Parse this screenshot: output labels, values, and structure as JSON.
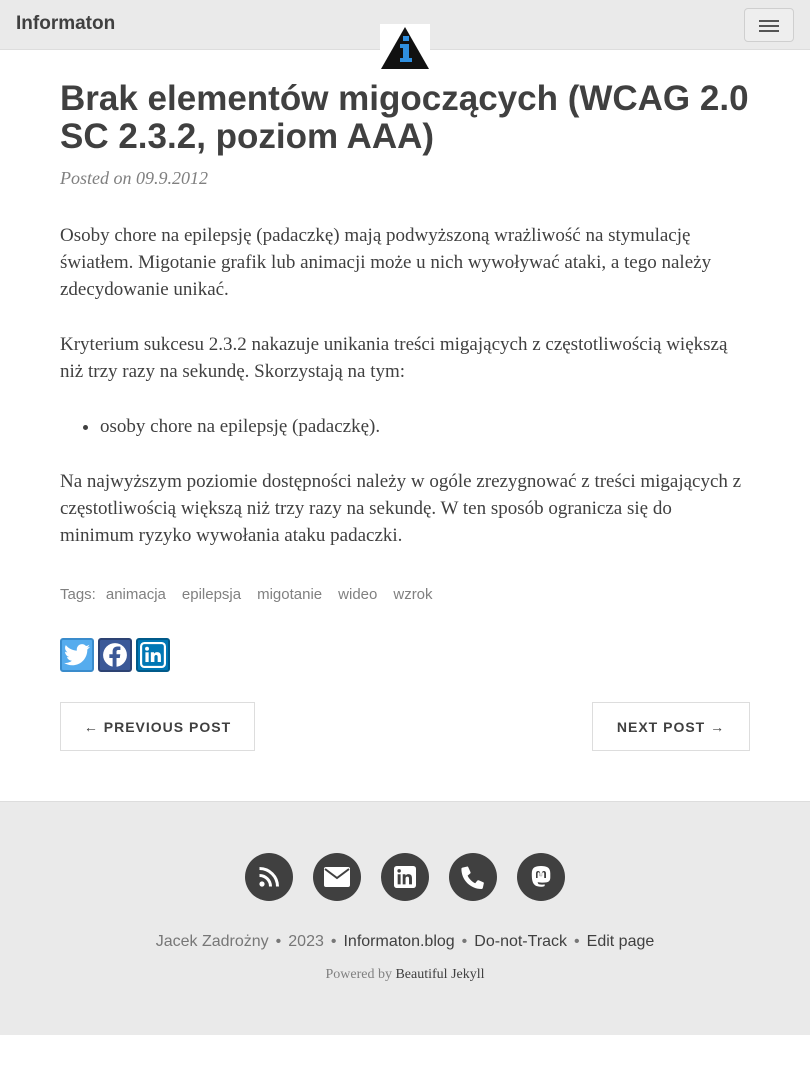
{
  "navbar": {
    "brand": "Informaton",
    "logo_icon": "info-triangle-logo",
    "menu_icon": "hamburger-icon"
  },
  "post": {
    "title": "Brak elementów migoczących (WCAG 2.0 SC 2.3.2, poziom AAA)",
    "meta": "Posted on 09.9.2012",
    "paragraphs": [
      "Osoby chore na epilepsję (padaczkę) mają podwyższoną wrażliwość na stymulację światłem. Migotanie grafik lub animacji może u nich wywoływać ataki, a tego należy zdecydowanie unikać.",
      "Kryterium sukcesu 2.3.2 nakazuje unikania treści migających z częstotliwością większą niż trzy razy na sekundę. Skorzystają na tym:",
      "Na najwyższym poziomie dostępności należy w ogóle zrezygnować z treści migających z częstotliwością większą niż trzy razy na sekundę. W ten sposób ogranicza się do minimum ryzyko wywołania ataku padaczki."
    ],
    "list_items": [
      "osoby chore na epilepsję (padaczkę)."
    ]
  },
  "tags": {
    "label": "Tags:",
    "items": [
      "animacja",
      "epilepsja",
      "migotanie",
      "wideo",
      "wzrok"
    ]
  },
  "share": {
    "icons": [
      "twitter-icon",
      "facebook-icon",
      "linkedin-icon"
    ],
    "colors": {
      "twitter": "#55acee",
      "facebook": "#3b5998",
      "linkedin": "#0077b5"
    }
  },
  "pager": {
    "previous": "← PREVIOUS POST",
    "next": "NEXT POST →"
  },
  "footer": {
    "social_icons": [
      "rss-icon",
      "envelope-icon",
      "linkedin-icon",
      "phone-icon",
      "mastodon-icon"
    ],
    "author": "Jacek Zadrożny",
    "year": "2023",
    "site": "Informaton.blog",
    "dnt": "Do-not-Track",
    "edit": "Edit page",
    "separator": "•",
    "powered_prefix": "Powered by",
    "powered_link": "Beautiful Jekyll"
  }
}
